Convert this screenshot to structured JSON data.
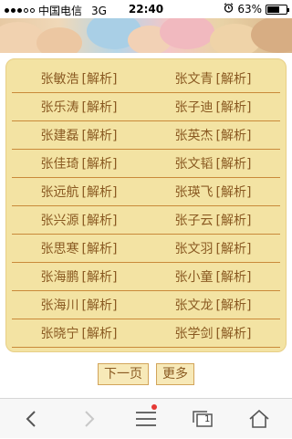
{
  "status_bar": {
    "carrier": "中国电信",
    "network": "3G",
    "time": "22:40",
    "battery_percent": "63%",
    "battery_level": 0.63
  },
  "list": {
    "rows": [
      [
        {
          "name": "张敏浩",
          "tag": "[解析]"
        },
        {
          "name": "张文青",
          "tag": "[解析]"
        }
      ],
      [
        {
          "name": "张乐涛",
          "tag": "[解析]"
        },
        {
          "name": "张子迪",
          "tag": "[解析]"
        }
      ],
      [
        {
          "name": "张建磊",
          "tag": "[解析]"
        },
        {
          "name": "张英杰",
          "tag": "[解析]"
        }
      ],
      [
        {
          "name": "张佳琦",
          "tag": "[解析]"
        },
        {
          "name": "张文韬",
          "tag": "[解析]"
        }
      ],
      [
        {
          "name": "张远航",
          "tag": "[解析]"
        },
        {
          "name": "张瑛飞",
          "tag": "[解析]"
        }
      ],
      [
        {
          "name": "张兴源",
          "tag": "[解析]"
        },
        {
          "name": "张子云",
          "tag": "[解析]"
        }
      ],
      [
        {
          "name": "张思寒",
          "tag": "[解析]"
        },
        {
          "name": "张文羽",
          "tag": "[解析]"
        }
      ],
      [
        {
          "name": "张海鹏",
          "tag": "[解析]"
        },
        {
          "name": "张小童",
          "tag": "[解析]"
        }
      ],
      [
        {
          "name": "张海川",
          "tag": "[解析]"
        },
        {
          "name": "张文龙",
          "tag": "[解析]"
        }
      ],
      [
        {
          "name": "张晓宁",
          "tag": "[解析]"
        },
        {
          "name": "张学剑",
          "tag": "[解析]"
        }
      ]
    ]
  },
  "pager": {
    "next_label": "下一页",
    "more_label": "更多"
  },
  "toolbar": {
    "tab_count": "1",
    "icons": [
      "back-icon",
      "forward-icon",
      "menu-icon",
      "tabs-icon",
      "home-icon"
    ]
  },
  "colors": {
    "panel_bg": "#f3e3a3",
    "row_divider": "#c98a3a",
    "text": "#8a5a22",
    "notification_dot": "#e53935"
  }
}
